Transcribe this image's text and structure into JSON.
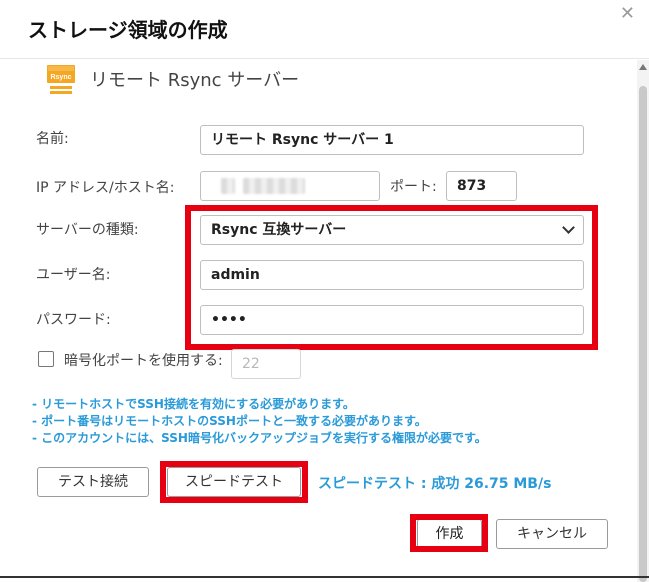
{
  "dialog": {
    "title": "ストレージ領域の作成",
    "close_icon": "close-icon"
  },
  "server": {
    "icon": "rsync-server-icon",
    "icon_text": "Rsync",
    "name": "リモート Rsync サーバー",
    "icon_color": "#f5a623"
  },
  "form": {
    "name_label": "名前:",
    "name_value": "リモート Rsync サーバー 1",
    "ip_label": "IP アドレス/ホスト名:",
    "port_label": "ポート:",
    "port_value": "873",
    "server_type_label": "サーバーの種類:",
    "server_type_value": "Rsync 互換サーバー",
    "username_label": "ユーザー名:",
    "username_value": "admin",
    "password_label": "パスワード:",
    "password_value": "••••",
    "encrypt_port_label": "暗号化ポートを使用する:",
    "encrypt_port_value": "22",
    "encrypt_checked": false
  },
  "notes": [
    "- リモートホストでSSH接続を有効にする必要があります。",
    "- ポート番号はリモートホストのSSHポートと一致する必要があります。",
    "- このアカウントには、SSH暗号化バックアップジョブを実行する権限が必要です。"
  ],
  "buttons": {
    "test_connection": "テスト接続",
    "speed_test": "スピードテスト",
    "speed_result": "スピードテスト : 成功 26.75 MB/s",
    "create": "作成",
    "cancel": "キャンセル"
  },
  "colors": {
    "highlight": "#e60012",
    "info_text": "#2a9ad8"
  }
}
